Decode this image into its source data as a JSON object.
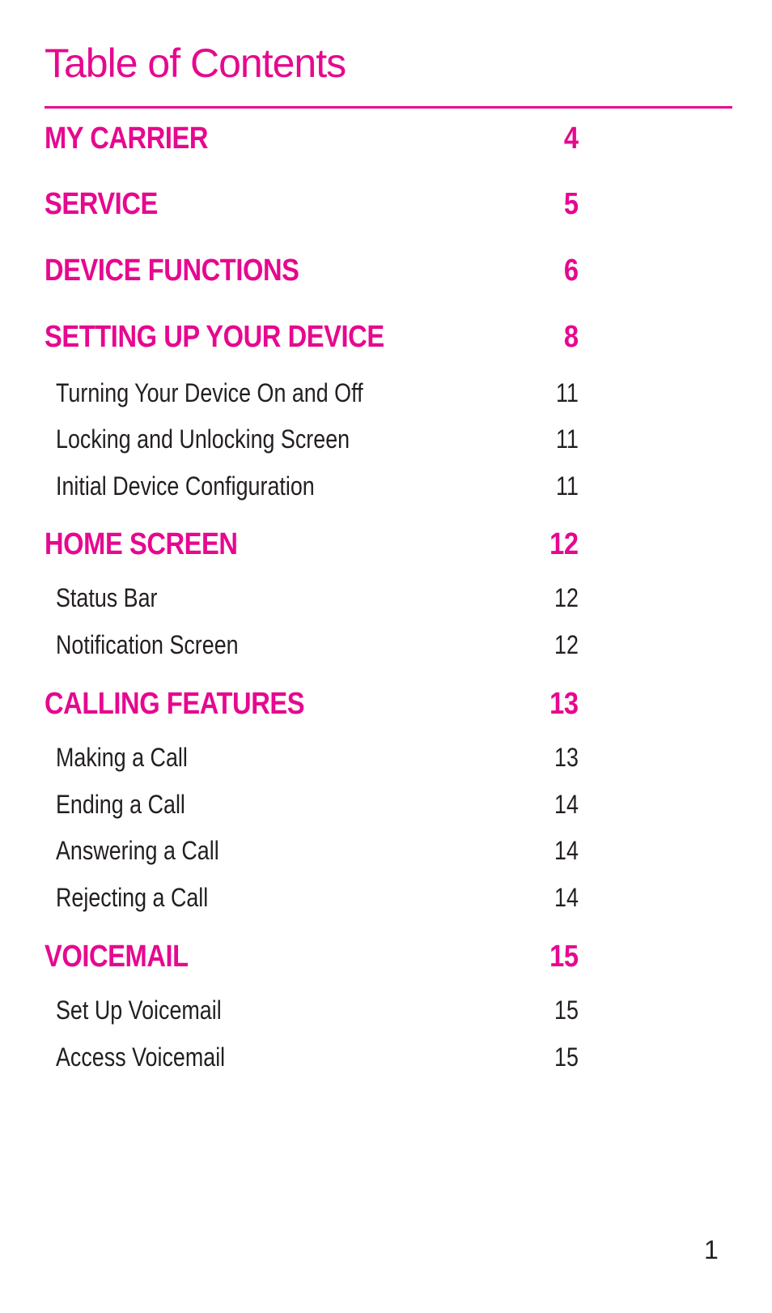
{
  "title": "Table of Contents",
  "accent_color": "#e6088f",
  "entries": [
    {
      "type": "section",
      "label": "MY CARRIER",
      "page": "4"
    },
    {
      "type": "section",
      "label": "SERVICE",
      "page": "5"
    },
    {
      "type": "section",
      "label": "DEVICE FUNCTIONS",
      "page": "6"
    },
    {
      "type": "section",
      "label": "SETTING UP YOUR DEVICE",
      "page": "8"
    },
    {
      "type": "sub",
      "label": "Turning Your Device On and Off",
      "page": "11"
    },
    {
      "type": "sub",
      "label": "Locking and Unlocking Screen",
      "page": "11"
    },
    {
      "type": "sub",
      "label": "Initial Device Configuration",
      "page": "11"
    },
    {
      "type": "section",
      "label": "HOME SCREEN",
      "page": "12"
    },
    {
      "type": "sub",
      "label": "Status Bar",
      "page": "12"
    },
    {
      "type": "sub",
      "label": "Notification Screen",
      "page": "12"
    },
    {
      "type": "section",
      "label": "CALLING FEATURES",
      "page": "13"
    },
    {
      "type": "sub",
      "label": "Making a Call",
      "page": "13"
    },
    {
      "type": "sub",
      "label": "Ending a Call",
      "page": "14"
    },
    {
      "type": "sub",
      "label": "Answering a Call",
      "page": "14"
    },
    {
      "type": "sub",
      "label": "Rejecting a Call",
      "page": "14"
    },
    {
      "type": "section",
      "label": "VOICEMAIL",
      "page": "15"
    },
    {
      "type": "sub",
      "label": "Set Up Voicemail",
      "page": "15"
    },
    {
      "type": "sub",
      "label": "Access Voicemail",
      "page": "15"
    }
  ],
  "page_number": "1"
}
